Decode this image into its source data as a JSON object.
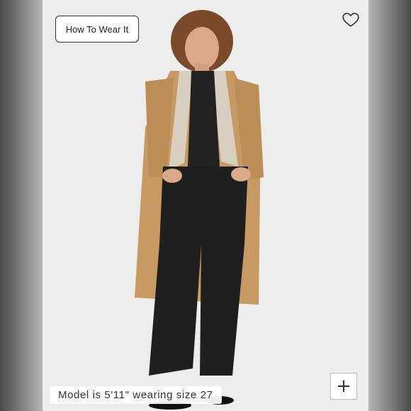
{
  "buttons": {
    "how_to_wear": "How To Wear It"
  },
  "caption": "Model is 5'11\" wearing size 27",
  "icons": {
    "favorite": "heart-icon",
    "zoom": "plus-icon"
  },
  "colors": {
    "coat": "#c79a63",
    "pants": "#1f1f1f",
    "background": "#ededed"
  }
}
